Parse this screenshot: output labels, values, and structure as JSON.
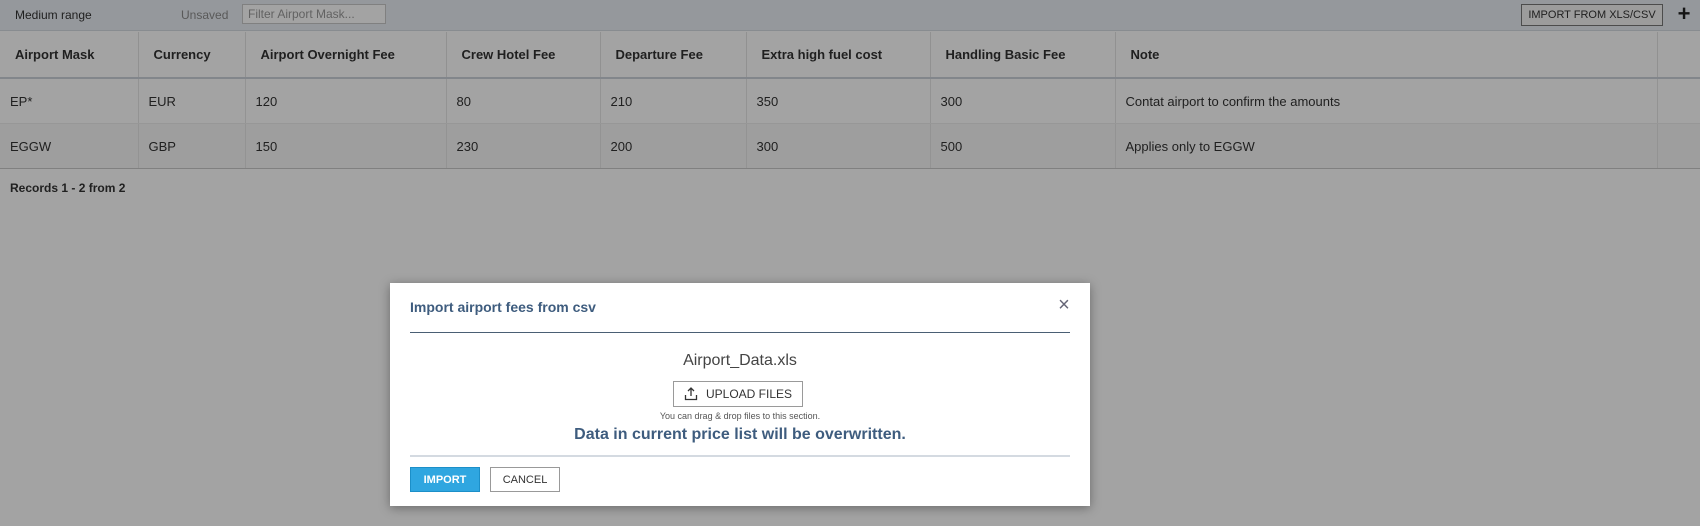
{
  "toolbar": {
    "price_list_name": "Medium range",
    "save_status": "Unsaved",
    "filter_placeholder": "Filter Airport Mask...",
    "import_button": "IMPORT FROM XLS/CSV",
    "add_icon": "plus-icon"
  },
  "table": {
    "columns": [
      "Airport Mask",
      "Currency",
      "Airport Overnight Fee",
      "Crew Hotel Fee",
      "Departure Fee",
      "Extra high fuel cost",
      "Handling Basic Fee",
      "Note"
    ],
    "rows": [
      [
        "EP*",
        "EUR",
        "120",
        "80",
        "210",
        "350",
        "300",
        "Contat airport to confirm the amounts"
      ],
      [
        "EGGW",
        "GBP",
        "150",
        "230",
        "200",
        "300",
        "500",
        "Applies only to EGGW"
      ]
    ]
  },
  "footer": {
    "records": "Records 1 - 2 from 2"
  },
  "modal": {
    "title": "Import airport fees from csv",
    "close_icon": "close-icon",
    "file_name": "Airport_Data.xls",
    "upload_button": "UPLOAD FILES",
    "upload_icon": "upload-icon",
    "drag_hint": "You can drag & drop files to this section.",
    "warning": "Data in current price list will be overwritten.",
    "import_button": "IMPORT",
    "cancel_button": "CANCEL"
  },
  "colors": {
    "accent_title": "#3e5c7e",
    "primary_button": "#2fa6e0"
  }
}
